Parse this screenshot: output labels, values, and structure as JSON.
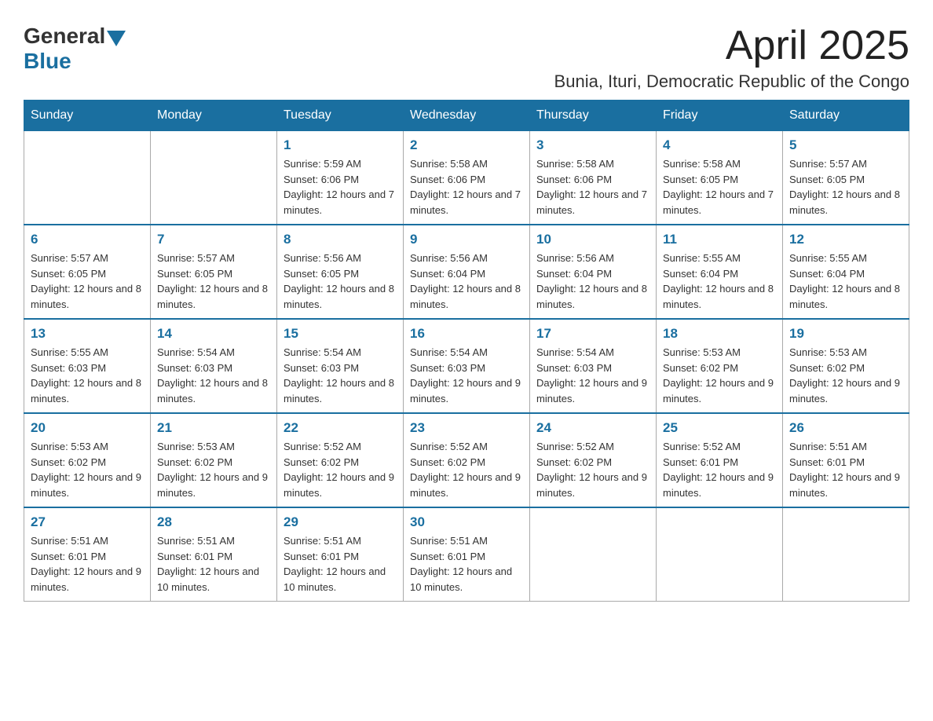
{
  "logo": {
    "text_general": "General",
    "text_blue": "Blue"
  },
  "title": {
    "month": "April 2025",
    "location": "Bunia, Ituri, Democratic Republic of the Congo"
  },
  "days_of_week": [
    "Sunday",
    "Monday",
    "Tuesday",
    "Wednesday",
    "Thursday",
    "Friday",
    "Saturday"
  ],
  "weeks": [
    [
      {
        "day": "",
        "info": ""
      },
      {
        "day": "",
        "info": ""
      },
      {
        "day": "1",
        "info": "Sunrise: 5:59 AM\nSunset: 6:06 PM\nDaylight: 12 hours\nand 7 minutes."
      },
      {
        "day": "2",
        "info": "Sunrise: 5:58 AM\nSunset: 6:06 PM\nDaylight: 12 hours\nand 7 minutes."
      },
      {
        "day": "3",
        "info": "Sunrise: 5:58 AM\nSunset: 6:06 PM\nDaylight: 12 hours\nand 7 minutes."
      },
      {
        "day": "4",
        "info": "Sunrise: 5:58 AM\nSunset: 6:05 PM\nDaylight: 12 hours\nand 7 minutes."
      },
      {
        "day": "5",
        "info": "Sunrise: 5:57 AM\nSunset: 6:05 PM\nDaylight: 12 hours\nand 8 minutes."
      }
    ],
    [
      {
        "day": "6",
        "info": "Sunrise: 5:57 AM\nSunset: 6:05 PM\nDaylight: 12 hours\nand 8 minutes."
      },
      {
        "day": "7",
        "info": "Sunrise: 5:57 AM\nSunset: 6:05 PM\nDaylight: 12 hours\nand 8 minutes."
      },
      {
        "day": "8",
        "info": "Sunrise: 5:56 AM\nSunset: 6:05 PM\nDaylight: 12 hours\nand 8 minutes."
      },
      {
        "day": "9",
        "info": "Sunrise: 5:56 AM\nSunset: 6:04 PM\nDaylight: 12 hours\nand 8 minutes."
      },
      {
        "day": "10",
        "info": "Sunrise: 5:56 AM\nSunset: 6:04 PM\nDaylight: 12 hours\nand 8 minutes."
      },
      {
        "day": "11",
        "info": "Sunrise: 5:55 AM\nSunset: 6:04 PM\nDaylight: 12 hours\nand 8 minutes."
      },
      {
        "day": "12",
        "info": "Sunrise: 5:55 AM\nSunset: 6:04 PM\nDaylight: 12 hours\nand 8 minutes."
      }
    ],
    [
      {
        "day": "13",
        "info": "Sunrise: 5:55 AM\nSunset: 6:03 PM\nDaylight: 12 hours\nand 8 minutes."
      },
      {
        "day": "14",
        "info": "Sunrise: 5:54 AM\nSunset: 6:03 PM\nDaylight: 12 hours\nand 8 minutes."
      },
      {
        "day": "15",
        "info": "Sunrise: 5:54 AM\nSunset: 6:03 PM\nDaylight: 12 hours\nand 8 minutes."
      },
      {
        "day": "16",
        "info": "Sunrise: 5:54 AM\nSunset: 6:03 PM\nDaylight: 12 hours\nand 9 minutes."
      },
      {
        "day": "17",
        "info": "Sunrise: 5:54 AM\nSunset: 6:03 PM\nDaylight: 12 hours\nand 9 minutes."
      },
      {
        "day": "18",
        "info": "Sunrise: 5:53 AM\nSunset: 6:02 PM\nDaylight: 12 hours\nand 9 minutes."
      },
      {
        "day": "19",
        "info": "Sunrise: 5:53 AM\nSunset: 6:02 PM\nDaylight: 12 hours\nand 9 minutes."
      }
    ],
    [
      {
        "day": "20",
        "info": "Sunrise: 5:53 AM\nSunset: 6:02 PM\nDaylight: 12 hours\nand 9 minutes."
      },
      {
        "day": "21",
        "info": "Sunrise: 5:53 AM\nSunset: 6:02 PM\nDaylight: 12 hours\nand 9 minutes."
      },
      {
        "day": "22",
        "info": "Sunrise: 5:52 AM\nSunset: 6:02 PM\nDaylight: 12 hours\nand 9 minutes."
      },
      {
        "day": "23",
        "info": "Sunrise: 5:52 AM\nSunset: 6:02 PM\nDaylight: 12 hours\nand 9 minutes."
      },
      {
        "day": "24",
        "info": "Sunrise: 5:52 AM\nSunset: 6:02 PM\nDaylight: 12 hours\nand 9 minutes."
      },
      {
        "day": "25",
        "info": "Sunrise: 5:52 AM\nSunset: 6:01 PM\nDaylight: 12 hours\nand 9 minutes."
      },
      {
        "day": "26",
        "info": "Sunrise: 5:51 AM\nSunset: 6:01 PM\nDaylight: 12 hours\nand 9 minutes."
      }
    ],
    [
      {
        "day": "27",
        "info": "Sunrise: 5:51 AM\nSunset: 6:01 PM\nDaylight: 12 hours\nand 9 minutes."
      },
      {
        "day": "28",
        "info": "Sunrise: 5:51 AM\nSunset: 6:01 PM\nDaylight: 12 hours\nand 10 minutes."
      },
      {
        "day": "29",
        "info": "Sunrise: 5:51 AM\nSunset: 6:01 PM\nDaylight: 12 hours\nand 10 minutes."
      },
      {
        "day": "30",
        "info": "Sunrise: 5:51 AM\nSunset: 6:01 PM\nDaylight: 12 hours\nand 10 minutes."
      },
      {
        "day": "",
        "info": ""
      },
      {
        "day": "",
        "info": ""
      },
      {
        "day": "",
        "info": ""
      }
    ]
  ]
}
